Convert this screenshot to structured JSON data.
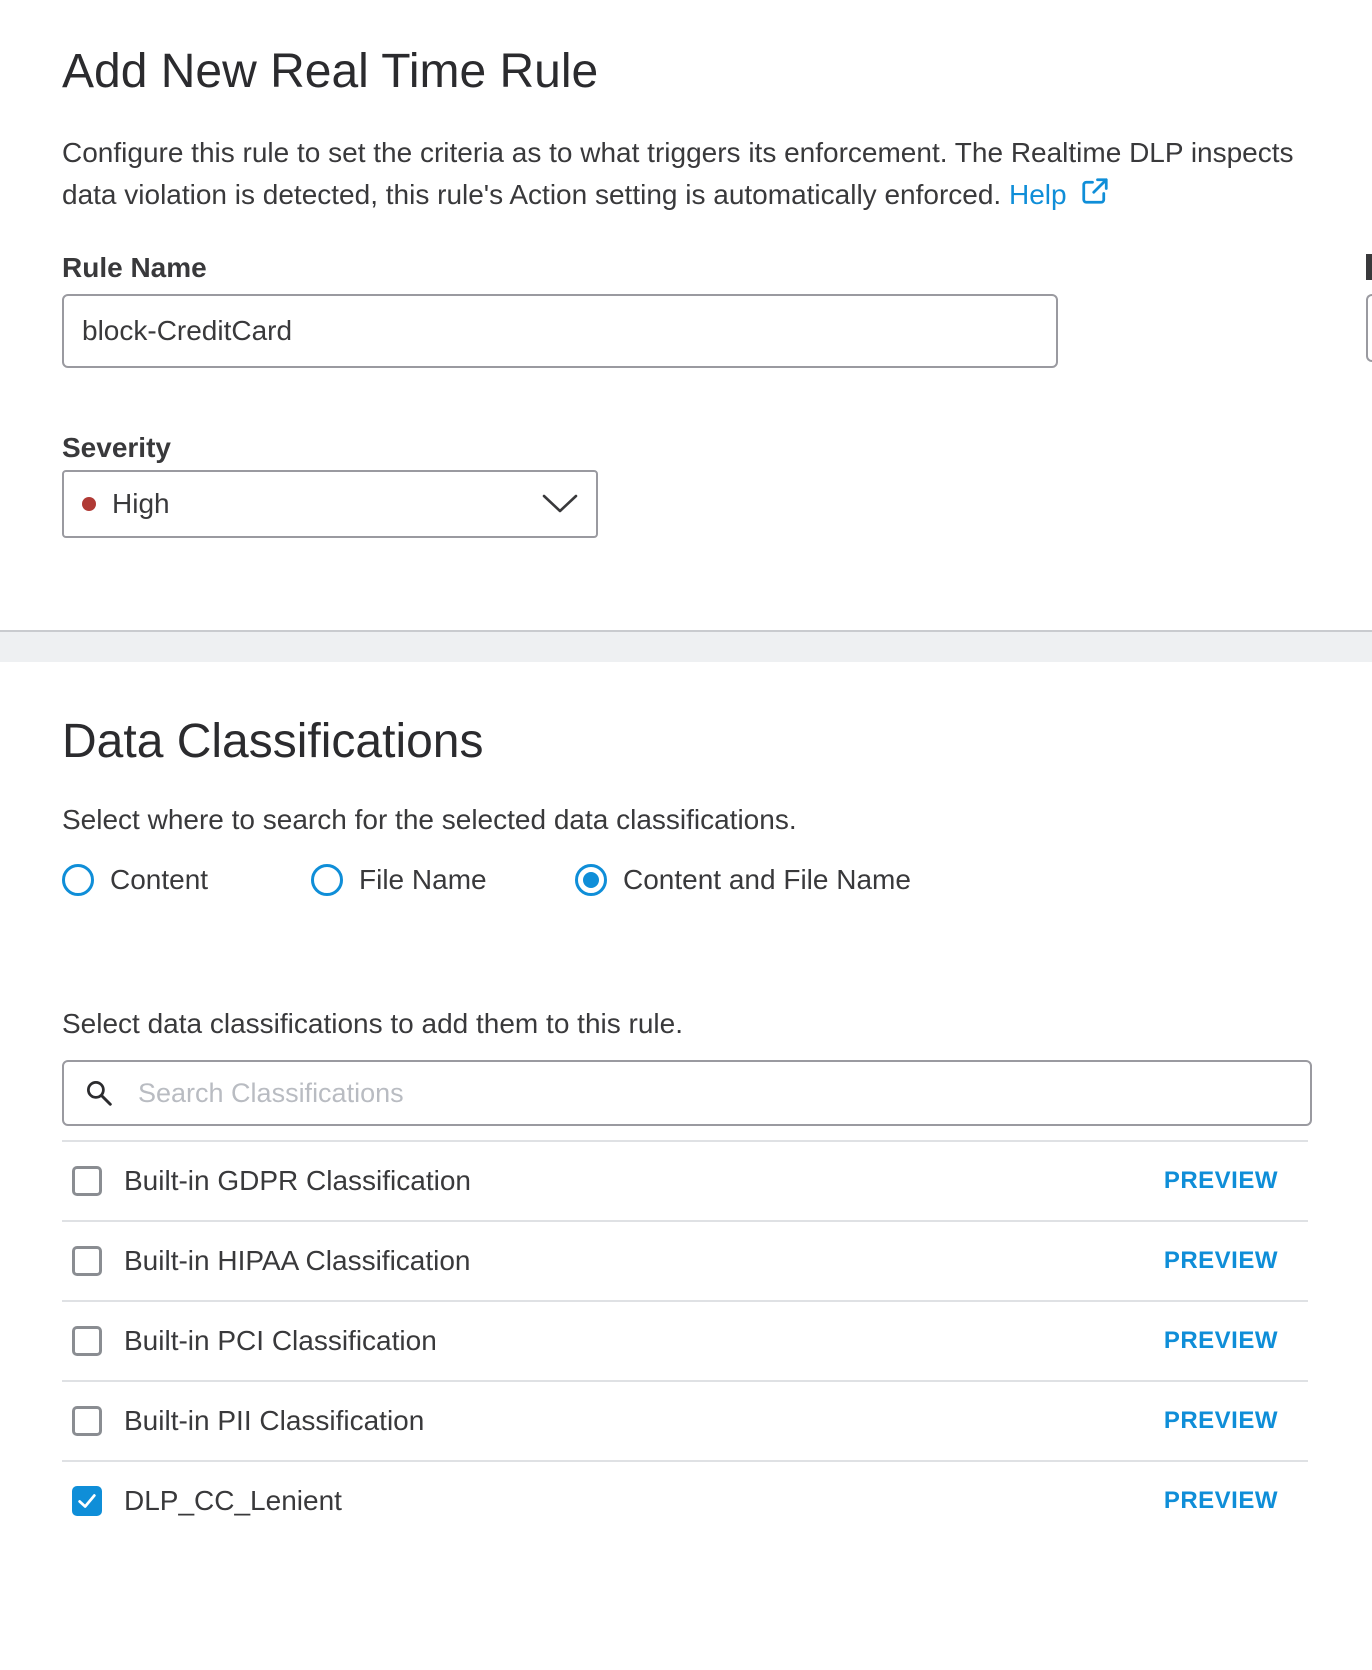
{
  "header": {
    "title": "Add New Real Time Rule",
    "description_line1": "Configure this rule to set the criteria as to what triggers its enforcement. The Realtime DLP inspects",
    "description_line2": "data violation is detected, this rule's Action setting is automatically enforced.",
    "help_label": "Help",
    "help_icon": "external-link-icon"
  },
  "form": {
    "rule_name_label": "Rule Name",
    "rule_name_value": "block-CreditCard",
    "severity_label": "Severity",
    "severity_value": "High",
    "severity_color": "#b03a35"
  },
  "classifications": {
    "title": "Data Classifications",
    "search_where_text": "Select where to search for the selected data classifications.",
    "options": [
      {
        "label": "Content",
        "selected": false
      },
      {
        "label": "File Name",
        "selected": false
      },
      {
        "label": "Content and File Name",
        "selected": true
      }
    ],
    "select_text": "Select data classifications to add them to this rule.",
    "search_placeholder": "Search Classifications",
    "items": [
      {
        "name": "Built-in GDPR Classification",
        "checked": false,
        "action": "PREVIEW"
      },
      {
        "name": "Built-in HIPAA Classification",
        "checked": false,
        "action": "PREVIEW"
      },
      {
        "name": "Built-in PCI Classification",
        "checked": false,
        "action": "PREVIEW"
      },
      {
        "name": "Built-in PII Classification",
        "checked": false,
        "action": "PREVIEW"
      },
      {
        "name": "DLP_CC_Lenient",
        "checked": true,
        "action": "PREVIEW"
      }
    ]
  },
  "colors": {
    "accent": "#0f8ed8",
    "text": "#39393b",
    "border": "#9a9aa0"
  }
}
